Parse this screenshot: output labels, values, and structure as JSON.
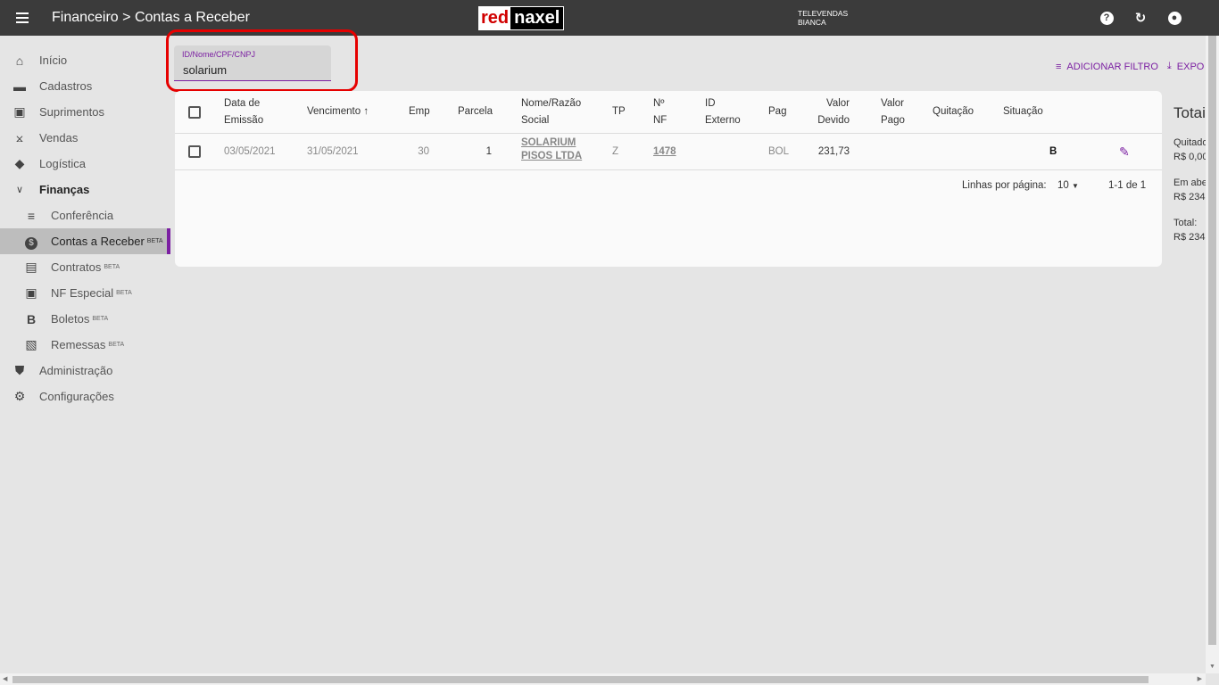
{
  "header": {
    "title": "Financeiro > Contas a Receber",
    "logo_red": "red",
    "logo_naxel": "naxel",
    "user_line1": "TELEVENDAS",
    "user_line2": "BIANCA"
  },
  "sidebar": {
    "items": [
      {
        "label": "Início",
        "icon": "home-icon"
      },
      {
        "label": "Cadastros",
        "icon": "folder-icon"
      },
      {
        "label": "Suprimentos",
        "icon": "briefcase-icon"
      },
      {
        "label": "Vendas",
        "icon": "cart-icon"
      },
      {
        "label": "Logística",
        "icon": "diamond-icon"
      },
      {
        "label": "Finanças",
        "icon": "chevron-down-icon"
      },
      {
        "label": "Conferência",
        "icon": "checklist-icon"
      },
      {
        "label": "Contas a Receber",
        "icon": "dollar-icon",
        "badge": "BETA"
      },
      {
        "label": "Contratos",
        "icon": "contract-icon",
        "badge": "BETA"
      },
      {
        "label": "NF Especial",
        "icon": "nf-icon",
        "badge": "BETA"
      },
      {
        "label": "Boletos",
        "icon": "boleto-icon",
        "badge": "BETA"
      },
      {
        "label": "Remessas",
        "icon": "image-stack-icon",
        "badge": "BETA"
      },
      {
        "label": "Administração",
        "icon": "shield-icon"
      },
      {
        "label": "Configurações",
        "icon": "gear-icon"
      }
    ]
  },
  "filter": {
    "label": "ID/Nome/CPF/CNPJ",
    "value": "solarium"
  },
  "actions": {
    "add_filter": "ADICIONAR FILTRO",
    "export": "EXPO"
  },
  "table": {
    "headers": {
      "emissao": [
        "Data de",
        "Emissão"
      ],
      "vencimento": "Vencimento",
      "emp": "Emp",
      "parcela": "Parcela",
      "nome": [
        "Nome/Razão",
        "Social"
      ],
      "tp": "TP",
      "nf": [
        "Nº",
        "NF"
      ],
      "id_externo": [
        "ID",
        "Externo"
      ],
      "pag": "Pag",
      "valor_devido": [
        "Valor",
        "Devido"
      ],
      "valor_pago": [
        "Valor",
        "Pago"
      ],
      "quitacao": "Quitação",
      "situacao": "Situação"
    },
    "rows": [
      {
        "emissao": "03/05/2021",
        "vencimento": "31/05/2021",
        "emp": "30",
        "parcela": "1",
        "nome_1": "SOLARIUM",
        "nome_2": "PISOS LTDA",
        "tp": "Z",
        "nf": "1478",
        "pag": "BOL",
        "valor_devido": "231,73",
        "situacao": "B"
      }
    ],
    "footer": {
      "rows_per_page_label": "Linhas por página:",
      "rows_per_page": "10",
      "range": "1-1 de 1"
    }
  },
  "totals": {
    "title": "Totai",
    "quitado_label": "Quitado",
    "quitado_value": "R$ 0,00",
    "aberto_label": "Em abe",
    "aberto_value": "R$ 234,",
    "total_label": "Total:",
    "total_value": "R$ 234,"
  },
  "colors": {
    "accent": "#7b1fa2",
    "topbar": "#3b3b3b",
    "highlight": "#e60000"
  }
}
